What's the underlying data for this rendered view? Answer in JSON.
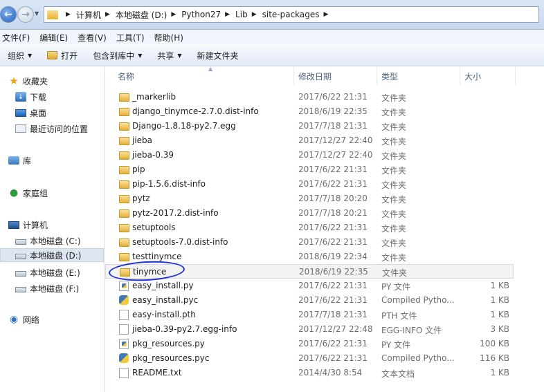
{
  "address": {
    "path": [
      "计算机",
      "本地磁盘 (D:)",
      "Python27",
      "Lib",
      "site-packages"
    ]
  },
  "menu": [
    "文件(F)",
    "编辑(E)",
    "查看(V)",
    "工具(T)",
    "帮助(H)"
  ],
  "toolbar": {
    "organize": "组织",
    "open": "打开",
    "include_in_library": "包含到库中",
    "share": "共享",
    "new_folder": "新建文件夹"
  },
  "nav": {
    "favorites": "收藏夹",
    "downloads": "下载",
    "desktop": "桌面",
    "recent": "最近访问的位置",
    "libraries": "库",
    "homegroup": "家庭组",
    "computer": "计算机",
    "drive_c": "本地磁盘 (C:)",
    "drive_d": "本地磁盘 (D:)",
    "drive_e": "本地磁盘 (E:)",
    "drive_f": "本地磁盘 (F:)",
    "network": "网络"
  },
  "columns": {
    "name": "名称",
    "date": "修改日期",
    "type": "类型",
    "size": "大小"
  },
  "files": [
    {
      "icon": "folder-icon",
      "name": "_markerlib",
      "date": "2017/6/22 21:31",
      "type": "文件夹",
      "size": ""
    },
    {
      "icon": "folder-icon",
      "name": "django_tinymce-2.7.0.dist-info",
      "date": "2018/6/19 22:35",
      "type": "文件夹",
      "size": ""
    },
    {
      "icon": "folder-icon",
      "name": "Django-1.8.18-py2.7.egg",
      "date": "2017/7/18 21:31",
      "type": "文件夹",
      "size": ""
    },
    {
      "icon": "folder-icon",
      "name": "jieba",
      "date": "2017/12/27 22:40",
      "type": "文件夹",
      "size": ""
    },
    {
      "icon": "folder-icon",
      "name": "jieba-0.39",
      "date": "2017/12/27 22:40",
      "type": "文件夹",
      "size": ""
    },
    {
      "icon": "folder-icon",
      "name": "pip",
      "date": "2017/6/22 21:31",
      "type": "文件夹",
      "size": ""
    },
    {
      "icon": "folder-icon",
      "name": "pip-1.5.6.dist-info",
      "date": "2017/6/22 21:31",
      "type": "文件夹",
      "size": ""
    },
    {
      "icon": "folder-icon",
      "name": "pytz",
      "date": "2017/7/18 20:20",
      "type": "文件夹",
      "size": ""
    },
    {
      "icon": "folder-icon",
      "name": "pytz-2017.2.dist-info",
      "date": "2017/7/18 20:21",
      "type": "文件夹",
      "size": ""
    },
    {
      "icon": "folder-icon",
      "name": "setuptools",
      "date": "2017/6/22 21:31",
      "type": "文件夹",
      "size": ""
    },
    {
      "icon": "folder-icon",
      "name": "setuptools-7.0.dist-info",
      "date": "2017/6/22 21:31",
      "type": "文件夹",
      "size": ""
    },
    {
      "icon": "folder-icon",
      "name": "testtinymce",
      "date": "2018/6/19 22:34",
      "type": "文件夹",
      "size": ""
    },
    {
      "icon": "folder-icon",
      "name": "tinymce",
      "date": "2018/6/19 22:35",
      "type": "文件夹",
      "size": ""
    },
    {
      "icon": "py-file-icon",
      "name": "easy_install.py",
      "date": "2017/6/22 21:31",
      "type": "PY 文件",
      "size": "1 KB"
    },
    {
      "icon": "pyc-file-icon",
      "name": "easy_install.pyc",
      "date": "2017/6/22 21:31",
      "type": "Compiled Pytho...",
      "size": "1 KB"
    },
    {
      "icon": "text-file-icon",
      "name": "easy-install.pth",
      "date": "2017/7/18 21:31",
      "type": "PTH 文件",
      "size": "1 KB"
    },
    {
      "icon": "text-file-icon",
      "name": "jieba-0.39-py2.7.egg-info",
      "date": "2017/12/27 22:48",
      "type": "EGG-INFO 文件",
      "size": "3 KB"
    },
    {
      "icon": "py-file-icon",
      "name": "pkg_resources.py",
      "date": "2017/6/22 21:31",
      "type": "PY 文件",
      "size": "100 KB"
    },
    {
      "icon": "pyc-file-icon",
      "name": "pkg_resources.pyc",
      "date": "2017/6/22 21:31",
      "type": "Compiled Pytho...",
      "size": "116 KB"
    },
    {
      "icon": "text-file-icon",
      "name": "README.txt",
      "date": "2014/4/30 8:54",
      "type": "文本文档",
      "size": "1 KB"
    }
  ],
  "selected_row": 12
}
